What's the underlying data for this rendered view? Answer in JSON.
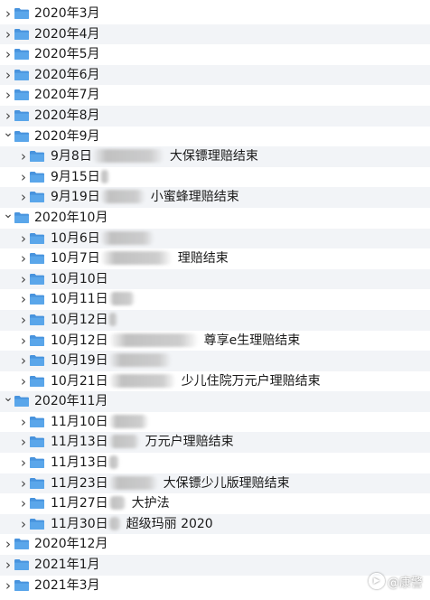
{
  "colors": {
    "folder": "#5aa6ea",
    "folder_tab": "#4893dd",
    "alt_row": "#f2f4f7"
  },
  "icons": {
    "expanded": "chevron-down-icon",
    "collapsed": "chevron-right-icon",
    "folder": "folder-icon"
  },
  "rows": [
    {
      "level": 0,
      "expanded": false,
      "label": "2020年3月"
    },
    {
      "level": 0,
      "expanded": false,
      "label": "2020年4月"
    },
    {
      "level": 0,
      "expanded": false,
      "label": "2020年5月"
    },
    {
      "level": 0,
      "expanded": false,
      "label": "2020年6月"
    },
    {
      "level": 0,
      "expanded": false,
      "label": "2020年7月"
    },
    {
      "level": 0,
      "expanded": false,
      "label": "2020年8月"
    },
    {
      "level": 0,
      "expanded": true,
      "label": "2020年9月"
    },
    {
      "level": 1,
      "expanded": false,
      "label": "9月8日",
      "redacted": 80,
      "suffix": "大保镖理赔结束"
    },
    {
      "level": 1,
      "expanded": false,
      "label": "9月15日",
      "redacted": 10,
      "suffix": ""
    },
    {
      "level": 1,
      "expanded": false,
      "label": "9月19日",
      "redacted": 50,
      "suffix": "小蜜蜂理赔结束"
    },
    {
      "level": 0,
      "expanded": true,
      "label": "2020年10月"
    },
    {
      "level": 1,
      "expanded": false,
      "label": "10月6日",
      "redacted": 60,
      "suffix": ""
    },
    {
      "level": 1,
      "expanded": false,
      "label": "10月7日",
      "redacted": 80,
      "suffix": "理赔结束"
    },
    {
      "level": 1,
      "expanded": false,
      "label": "10月10日",
      "redacted": 0,
      "suffix": ""
    },
    {
      "level": 1,
      "expanded": false,
      "label": "10月11日",
      "redacted": 30,
      "suffix": ""
    },
    {
      "level": 1,
      "expanded": false,
      "label": "10月12日",
      "redacted": 10,
      "suffix": ""
    },
    {
      "level": 1,
      "expanded": false,
      "label": "10月12日",
      "redacted": 100,
      "suffix": "尊享e生理赔结束"
    },
    {
      "level": 1,
      "expanded": false,
      "label": "10月19日",
      "redacted": 70,
      "suffix": ""
    },
    {
      "level": 1,
      "expanded": false,
      "label": "10月21日",
      "redacted": 75,
      "suffix": "少儿住院万元户理赔结束"
    },
    {
      "level": 0,
      "expanded": true,
      "label": "2020年11月"
    },
    {
      "level": 1,
      "expanded": false,
      "label": "11月10日",
      "redacted": 45,
      "suffix": ""
    },
    {
      "level": 1,
      "expanded": false,
      "label": "11月13日",
      "redacted": 35,
      "suffix": "万元户理赔结束"
    },
    {
      "level": 1,
      "expanded": false,
      "label": "11月13日",
      "redacted": 12,
      "suffix": ""
    },
    {
      "level": 1,
      "expanded": false,
      "label": "11月23日",
      "redacted": 55,
      "suffix": "大保镖少儿版理赔结束"
    },
    {
      "level": 1,
      "expanded": false,
      "label": "11月27日",
      "redacted": 20,
      "suffix": "大护法"
    },
    {
      "level": 1,
      "expanded": false,
      "label": "11月30日",
      "redacted": 14,
      "suffix": "超级玛丽 2020"
    },
    {
      "level": 0,
      "expanded": false,
      "label": "2020年12月"
    },
    {
      "level": 0,
      "expanded": false,
      "label": "2021年1月"
    },
    {
      "level": 0,
      "expanded": false,
      "label": "2021年3月"
    }
  ],
  "watermark": {
    "text": "@康警"
  }
}
